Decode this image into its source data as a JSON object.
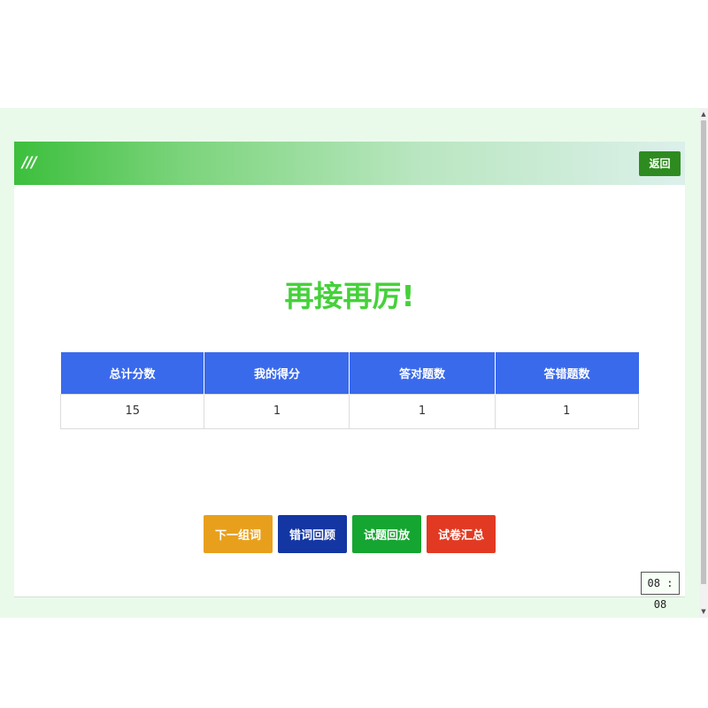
{
  "header": {
    "menu_icon_text": "///",
    "back_label": "返回",
    "gradient_start_color": "#3cbf3c"
  },
  "result": {
    "title": "再接再厉!",
    "title_color": "#45d13a"
  },
  "score_table": {
    "headers": [
      "总计分数",
      "我的得分",
      "答对题数",
      "答错题数"
    ],
    "rows": [
      [
        "15",
        "1",
        "1",
        "1"
      ]
    ],
    "header_color": "#3a6aec"
  },
  "actions": [
    {
      "label": "下一组词",
      "color": "#e8a01c"
    },
    {
      "label": "错词回顾",
      "color": "#1336a3"
    },
    {
      "label": "试题回放",
      "color": "#15a531"
    },
    {
      "label": "试卷汇总",
      "color": "#e23a22"
    }
  ],
  "timer": {
    "value": "08 : 08"
  },
  "scrollbar": {
    "up_icon": "▲",
    "down_icon": "▼"
  }
}
